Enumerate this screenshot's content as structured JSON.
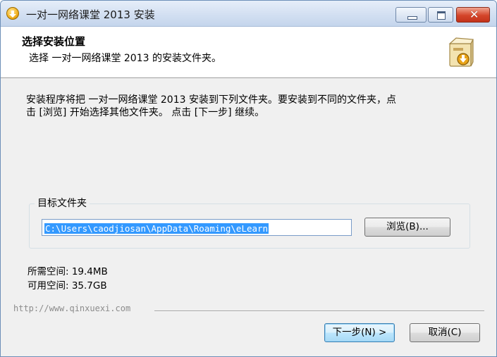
{
  "window": {
    "title": "一对一网络课堂 2013 安装"
  },
  "header": {
    "title": "选择安装位置",
    "subtitle": "选择 一对一网络课堂 2013 的安装文件夹。"
  },
  "body": {
    "intro_line1": "安装程序将把 一对一网络课堂 2013 安装到下列文件夹。要安装到不同的文件夹，点",
    "intro_line2": "击 [浏览] 开始选择其他文件夹。 点击 [下一步] 继续。"
  },
  "destination": {
    "group_label": "目标文件夹",
    "path_value": "C:\\Users\\caodjiosan\\AppData\\Roaming\\eLearn",
    "browse_label": "浏览(B)..."
  },
  "space": {
    "required": "所需空间: 19.4MB",
    "available": "可用空间: 35.7GB"
  },
  "footer": {
    "url": "http://www.qinxuexi.com",
    "next_label": "下一步(N) >",
    "cancel_label": "取消(C)"
  },
  "colors": {
    "selection": "#3399ff",
    "title_gradient_bottom": "#c4d5ec",
    "close_button": "#d4452a"
  },
  "icons": [
    "installer-app-icon",
    "minimize-icon",
    "maximize-icon",
    "close-icon",
    "setup-box-icon"
  ]
}
